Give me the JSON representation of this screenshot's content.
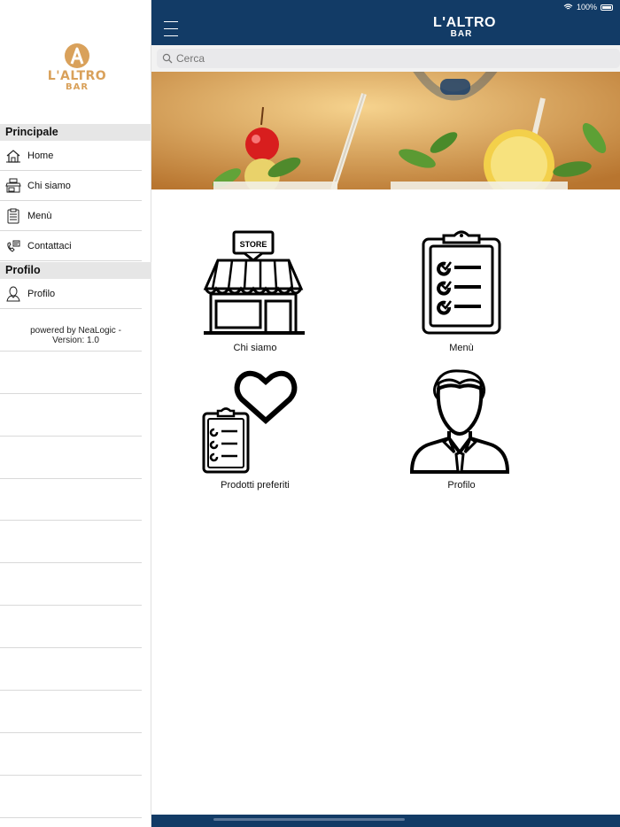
{
  "status_bar": {
    "battery": "100%"
  },
  "sidebar": {
    "logo": {
      "line1": "L'ALTRO",
      "line2": "BAR"
    },
    "sections": [
      {
        "title": "Principale",
        "items": [
          {
            "label": "Home",
            "icon": "house-icon"
          },
          {
            "label": "Chi siamo",
            "icon": "store-icon"
          },
          {
            "label": "Menù",
            "icon": "clipboard-icon"
          },
          {
            "label": "Contattaci",
            "icon": "phone-icon"
          }
        ]
      },
      {
        "title": "Profilo",
        "items": [
          {
            "label": "Profilo",
            "icon": "user-icon"
          }
        ]
      }
    ],
    "footer": {
      "line1": "powered by NeaLogic -",
      "line2": "Version: 1.0"
    }
  },
  "header": {
    "logo_line1": "L'ALTRO",
    "logo_line2": "BAR",
    "menu_icon": "hamburger-icon"
  },
  "search": {
    "placeholder": "Cerca"
  },
  "tiles": [
    {
      "label": "Chi siamo",
      "icon": "store-icon"
    },
    {
      "label": "Menù",
      "icon": "clipboard-checklist-icon"
    },
    {
      "label": "Prodotti preferiti",
      "icon": "heart-clipboard-icon"
    },
    {
      "label": "Profilo",
      "icon": "user-avatar-icon"
    }
  ],
  "colors": {
    "brand_navy": "#123b66",
    "logo_gold": "#d9a15b"
  }
}
